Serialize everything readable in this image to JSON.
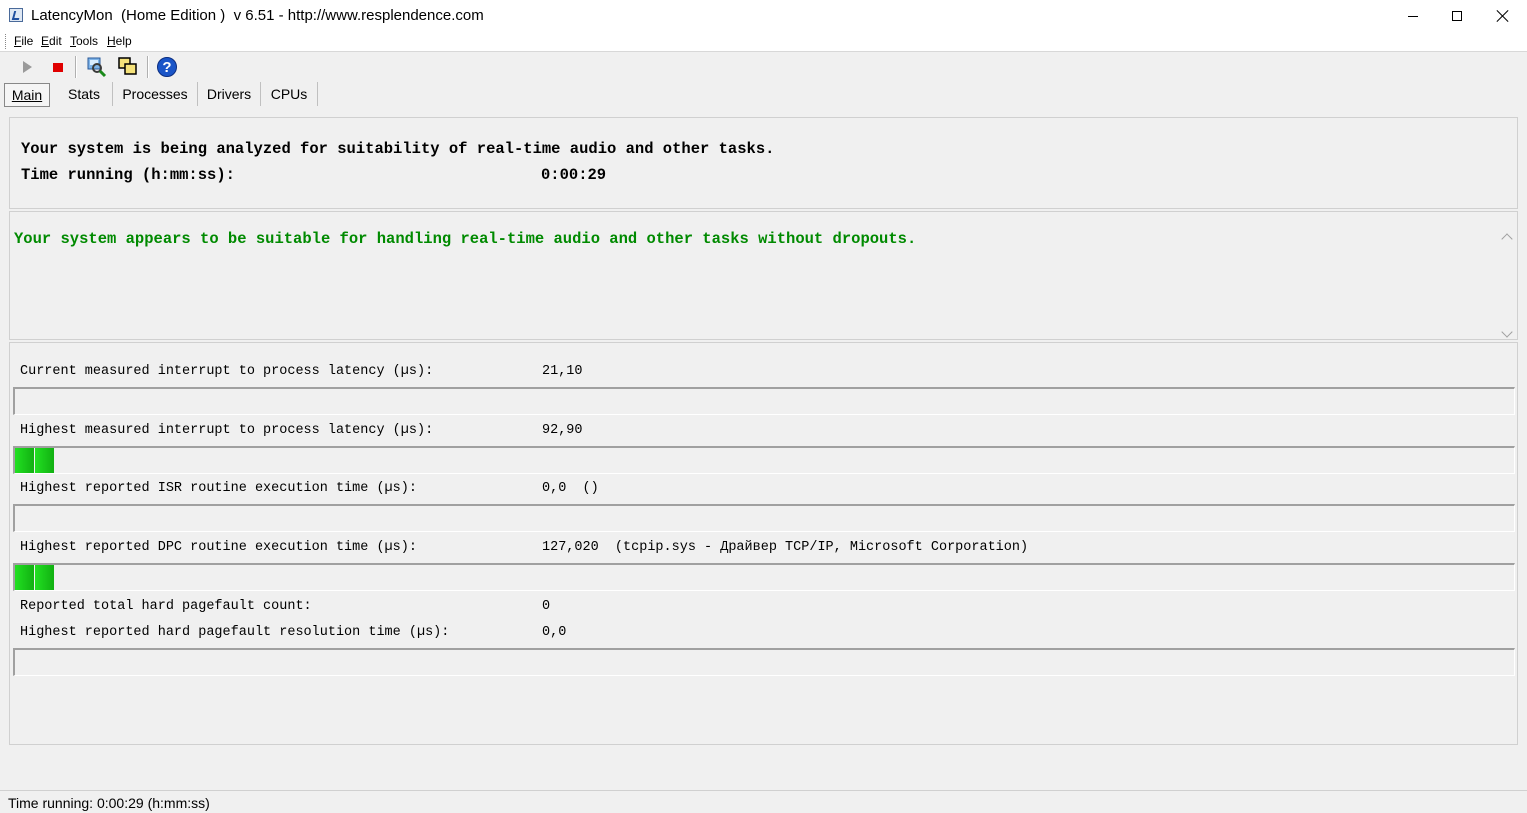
{
  "window": {
    "title": "LatencyMon  (Home Edition )  v 6.51 - http://www.resplendence.com"
  },
  "menu": [
    {
      "key": "F",
      "rest": "ile"
    },
    {
      "key": "E",
      "rest": "dit"
    },
    {
      "key": "T",
      "rest": "ools"
    },
    {
      "key": "H",
      "rest": "elp"
    }
  ],
  "toolbar": {
    "start_icon": "play-icon",
    "stop_icon": "stop-icon",
    "drivers_icon": "magnifier-icon",
    "windows_icon": "windows-icon",
    "help_icon": "help-icon",
    "help_glyph": "?"
  },
  "tabs": [
    "Main",
    "Stats",
    "Processes",
    "Drivers",
    "CPUs"
  ],
  "header": {
    "analyzing": "Your system is being analyzed for suitability of real-time audio and other tasks.",
    "time_label": "Time running (h:mm:ss):",
    "time_value": "0:00:29"
  },
  "verdict": {
    "message": "Your system appears to be suitable for handling real-time audio and other tasks without dropouts.",
    "color": "#008a00"
  },
  "metrics": {
    "current_latency": {
      "label": "Current measured interrupt to process latency (µs):",
      "value": "21,10",
      "bar_segments": 0
    },
    "highest_latency": {
      "label": "Highest measured interrupt to process latency (µs):",
      "value": "92,90",
      "bar_segments": 2
    },
    "isr": {
      "label": "Highest reported ISR routine execution time (µs):",
      "value": "0,0  ()",
      "bar_segments": 0
    },
    "dpc": {
      "label": "Highest reported DPC routine execution time (µs):",
      "value": "127,020  (tcpip.sys - Драйвер TCP/IP, Microsoft Corporation)",
      "bar_segments": 2
    },
    "pagefault_count": {
      "label": "Reported total hard pagefault count:",
      "value": "0"
    },
    "pagefault_time": {
      "label": "Highest reported hard pagefault resolution time (µs):",
      "value": "0,0",
      "bar_segments": 0
    }
  },
  "status": {
    "text": "Time running: 0:00:29  (h:mm:ss)"
  },
  "colors": {
    "bar_fill": "#11b011",
    "stop": "#e00000",
    "help": "#1a55c8"
  }
}
